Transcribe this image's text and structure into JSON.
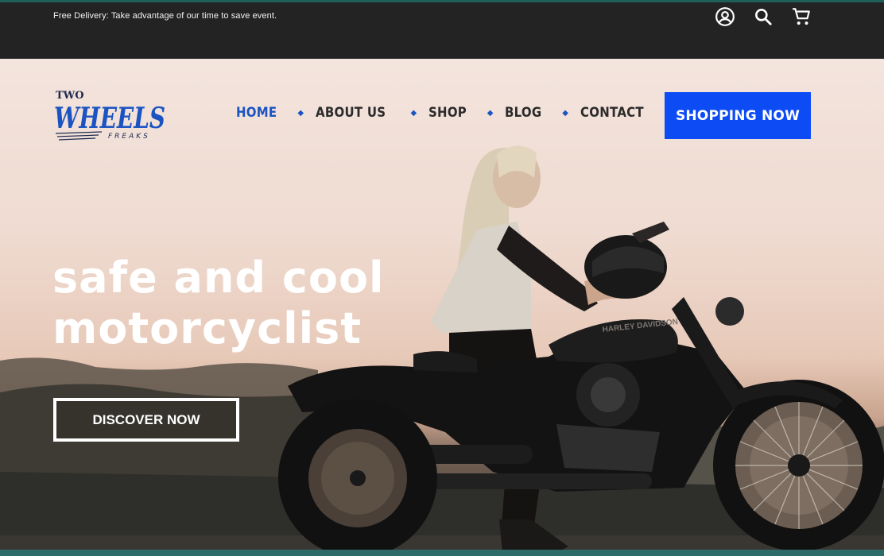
{
  "topbar": {
    "promo": "Free Delivery: Take advantage of our time to save event.",
    "icons": [
      "account-icon",
      "search-icon",
      "cart-icon"
    ]
  },
  "header": {
    "logo_text": {
      "small": "TWO",
      "main": "WHEELS",
      "sub": "FREAKS"
    },
    "nav": [
      {
        "label": "HOME",
        "active": true
      },
      {
        "label": "ABOUT US",
        "active": false
      },
      {
        "label": "SHOP",
        "active": false
      },
      {
        "label": "BLOG",
        "active": false
      },
      {
        "label": "CONTACT",
        "active": false
      }
    ],
    "cta_label": "SHOPPING NOW"
  },
  "hero": {
    "headline_line1": "safe and cool",
    "headline_line2": "motorcyclist",
    "button_label": "DISCOVER NOW",
    "tank_text": "HARLEY DAVIDSON"
  },
  "colors": {
    "accent_blue": "#0d4cf5",
    "nav_active": "#1b54c2",
    "topbar_bg": "#232323"
  }
}
